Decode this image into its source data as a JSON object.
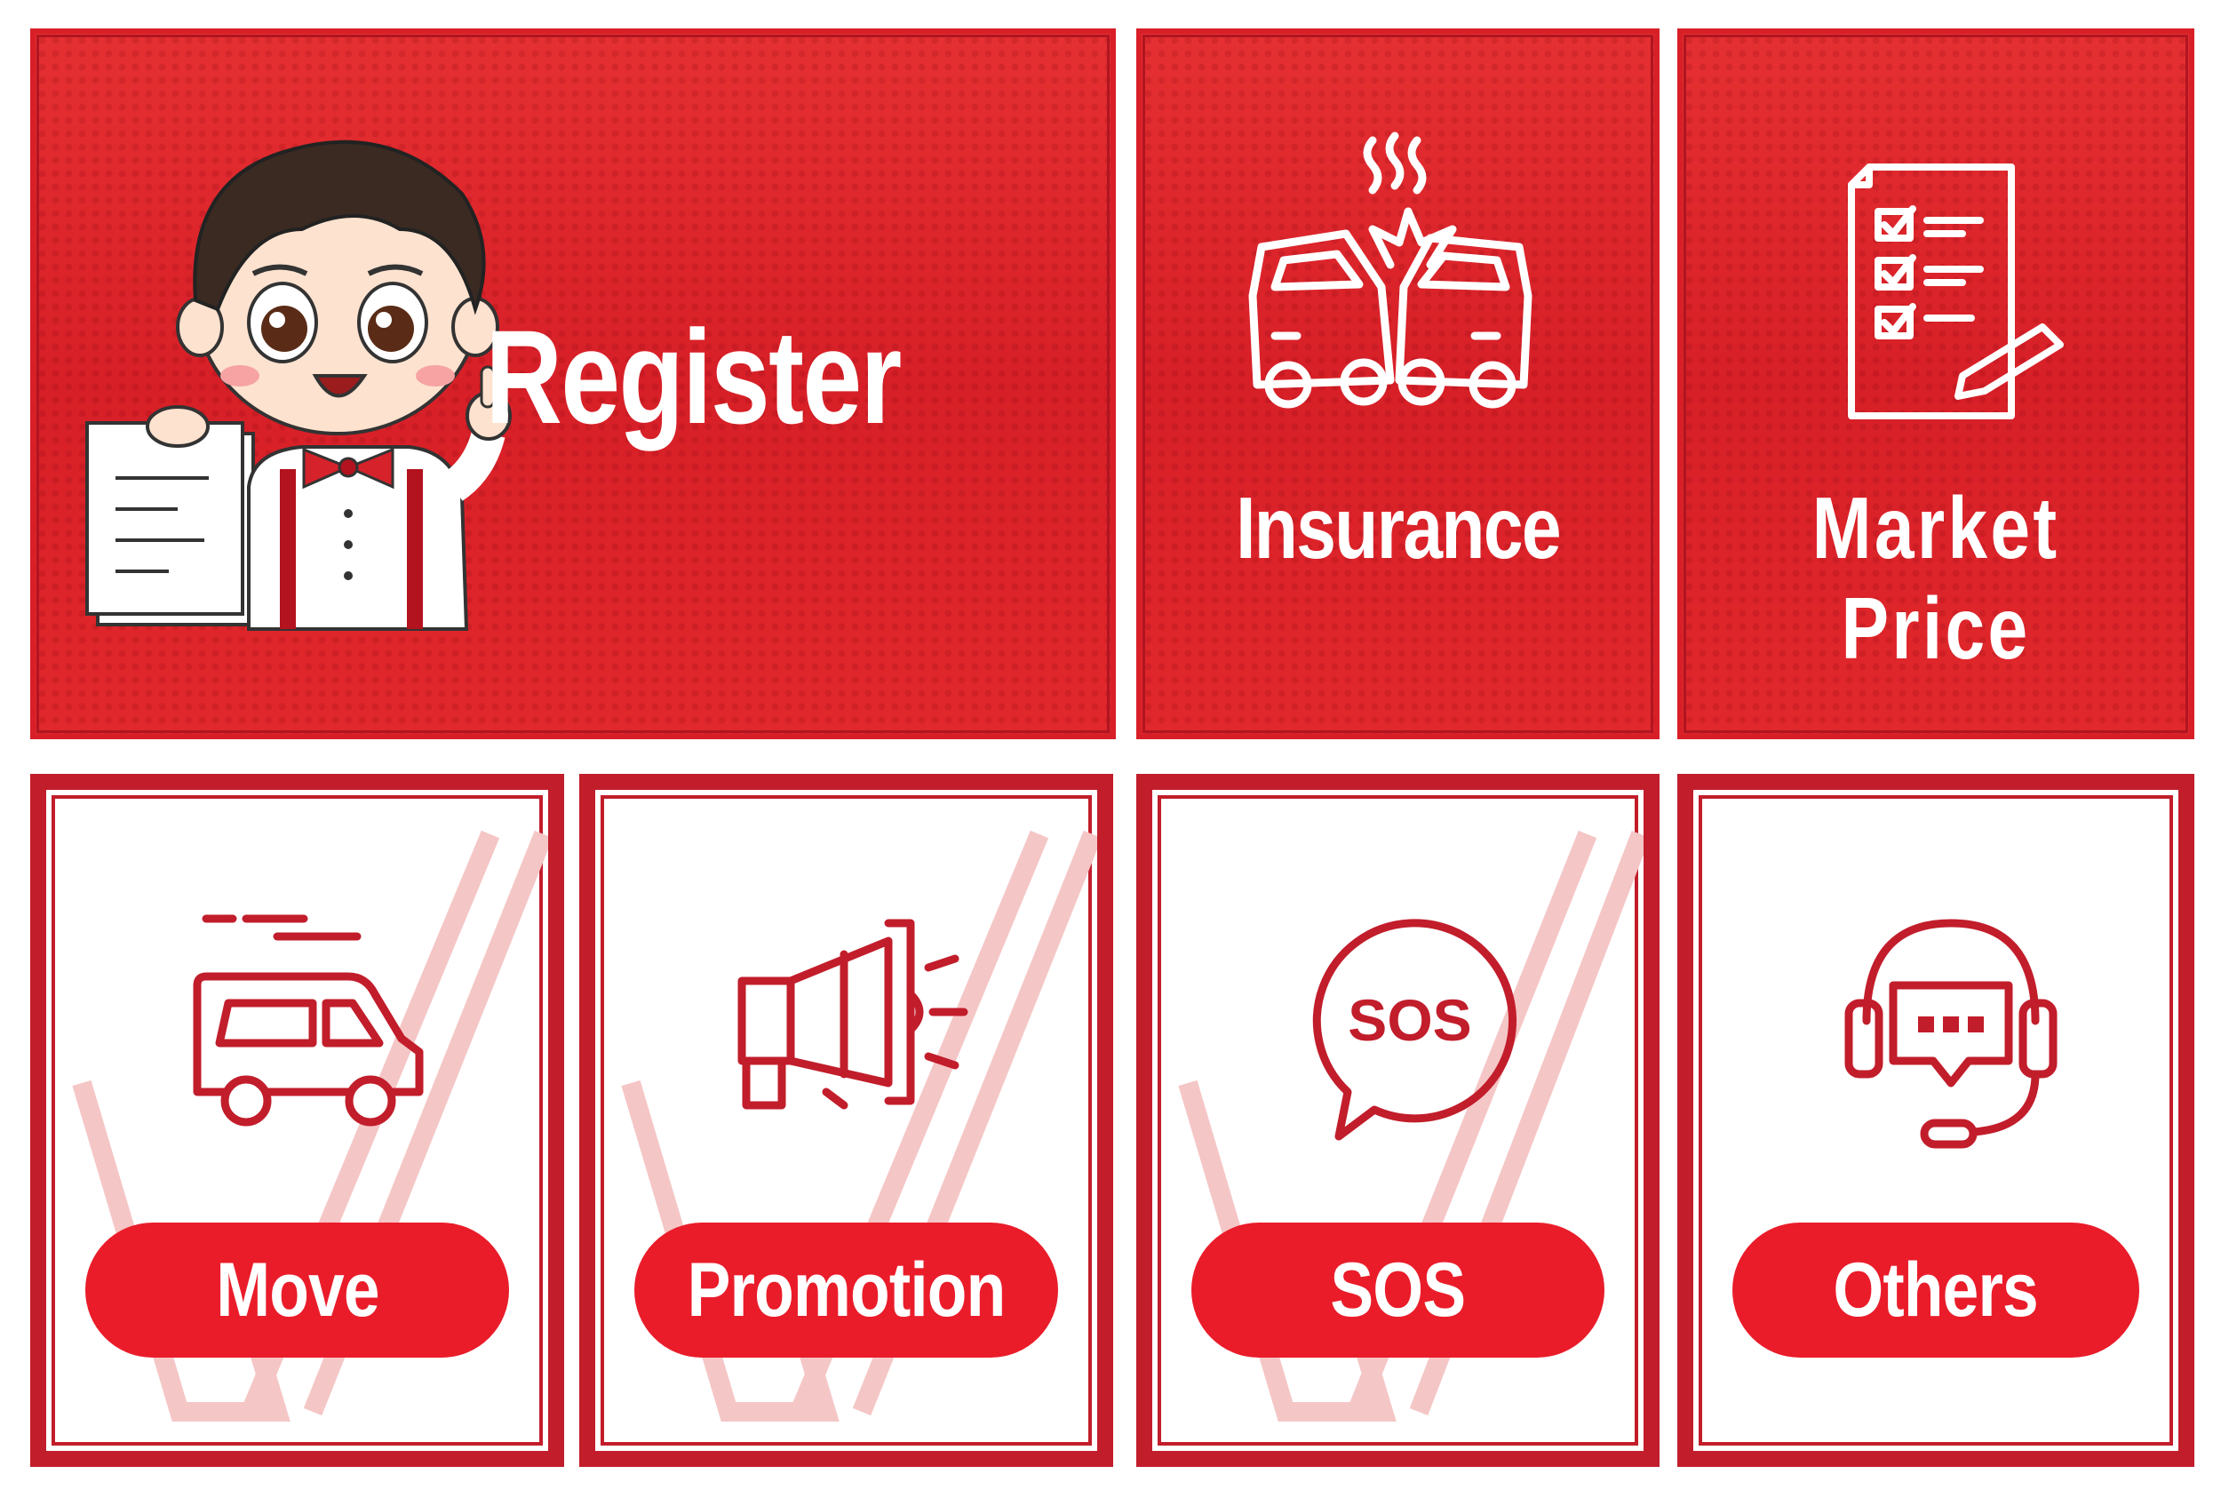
{
  "tiles": {
    "register": {
      "label": "Register"
    },
    "insurance": {
      "label": "Insurance"
    },
    "market_price": {
      "label": "Market Price"
    }
  },
  "buttons": {
    "move": {
      "label": "Move"
    },
    "promotion": {
      "label": "Promotion"
    },
    "sos": {
      "label": "SOS"
    },
    "others": {
      "label": "Others"
    }
  },
  "icons": {
    "sos_bubble_text": "SOS",
    "register": "mascot-holding-document-icon",
    "insurance": "car-crash-icon",
    "market_price": "checklist-icon",
    "move": "moving-van-icon",
    "promotion": "megaphone-icon",
    "sos": "sos-speech-bubble-icon",
    "others": "headset-support-icon"
  },
  "colors": {
    "brand_red": "#e0262b",
    "frame_red": "#c21d2b",
    "pill_red": "#ea1c2a",
    "text_white": "#ffffff"
  }
}
